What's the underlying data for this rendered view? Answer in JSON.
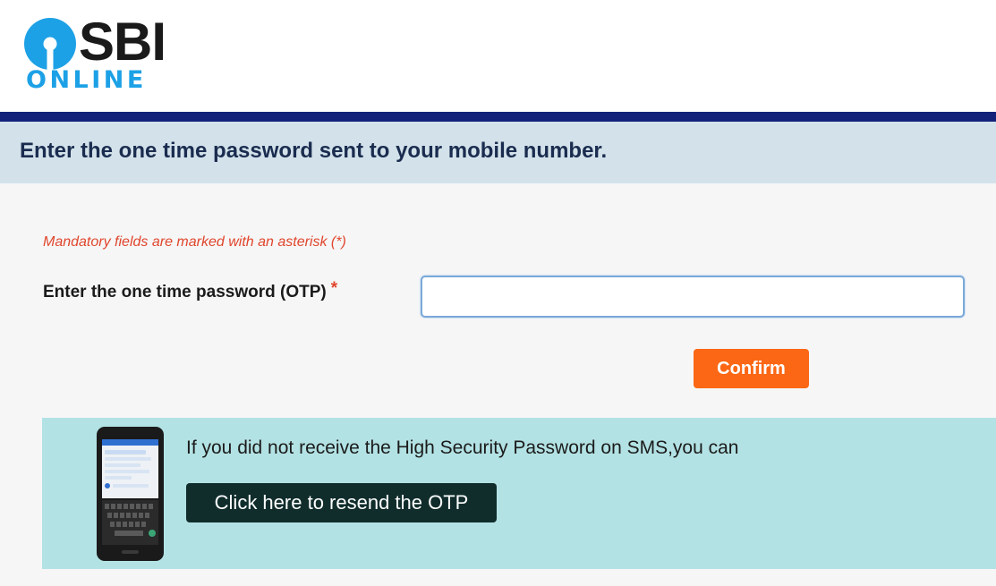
{
  "header": {
    "logo_sbi": "SBI",
    "logo_online": "ONLINE",
    "brand_color": "#1da1e6",
    "nav_bar_color": "#13237a"
  },
  "page": {
    "title": "Enter the one time password sent to your mobile number.",
    "mandatory_note": "Mandatory fields are marked with an asterisk (*)"
  },
  "otp_form": {
    "label": "Enter the one time password (OTP)",
    "required_marker": "*",
    "input_value": "",
    "input_placeholder": "",
    "confirm_label": "Confirm",
    "confirm_color": "#fb6714"
  },
  "resend_panel": {
    "message": "If you did not receive the High Security Password on SMS,you can",
    "button_label": "Click here to resend the OTP",
    "phone_icon": "smartphone-icon",
    "panel_color": "#b3e2e4",
    "button_color": "#102d2c"
  }
}
